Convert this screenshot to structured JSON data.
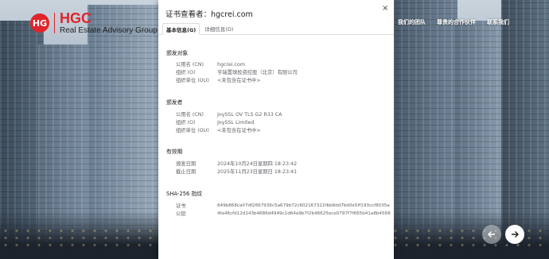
{
  "website": {
    "logo_mark": "HG",
    "brand": "HGC",
    "tagline": "Real Estate Advisory Group",
    "nav": [
      "我们的团队",
      "尊贵的合作伙伴",
      "联系我们"
    ],
    "carousel": {
      "prev_icon": "arrow-left-icon",
      "next_icon": "arrow-right-icon"
    }
  },
  "dialog": {
    "title": "证书查看者：hgcrei.com",
    "close_label": "×",
    "tabs": [
      "基本信息(G)",
      "详细信息(D)"
    ],
    "issued_to": {
      "heading": "颁发对象",
      "rows": [
        {
          "k": "公用名 (CN)",
          "v": "hgcrei.com"
        },
        {
          "k": "组织 (O)",
          "v": "亨瑞置球投资控股（北京）有限公司"
        },
        {
          "k": "组织单位 (OU)",
          "v": "<未包含在证书中>"
        }
      ]
    },
    "issued_by": {
      "heading": "颁发者",
      "rows": [
        {
          "k": "公用名 (CN)",
          "v": "JoySSL OV TLS G2 R33 CA"
        },
        {
          "k": "组织 (O)",
          "v": "JoySSL Limited"
        },
        {
          "k": "组织单位 (OU)",
          "v": "<未包含在证书中>"
        }
      ]
    },
    "validity": {
      "heading": "有效期",
      "rows": [
        {
          "k": "颁发日期",
          "v": "2024年10月24日星期四 18:23:42"
        },
        {
          "k": "截止日期",
          "v": "2025年11月23日星期日 18:23:41"
        }
      ]
    },
    "fingerprints": {
      "heading": "SHA-256 指纹",
      "rows": [
        {
          "k": "证书",
          "v": "649b868ca07df2667936c5a679b72c602167322fbb8dd7bd0e5ff193ccf8035a"
        },
        {
          "k": "公钥",
          "v": "4fa46cfd12d143b4686d4949c1d64a9b7f2b46625ece0797f7f665b41a8b4568"
        }
      ]
    }
  }
}
